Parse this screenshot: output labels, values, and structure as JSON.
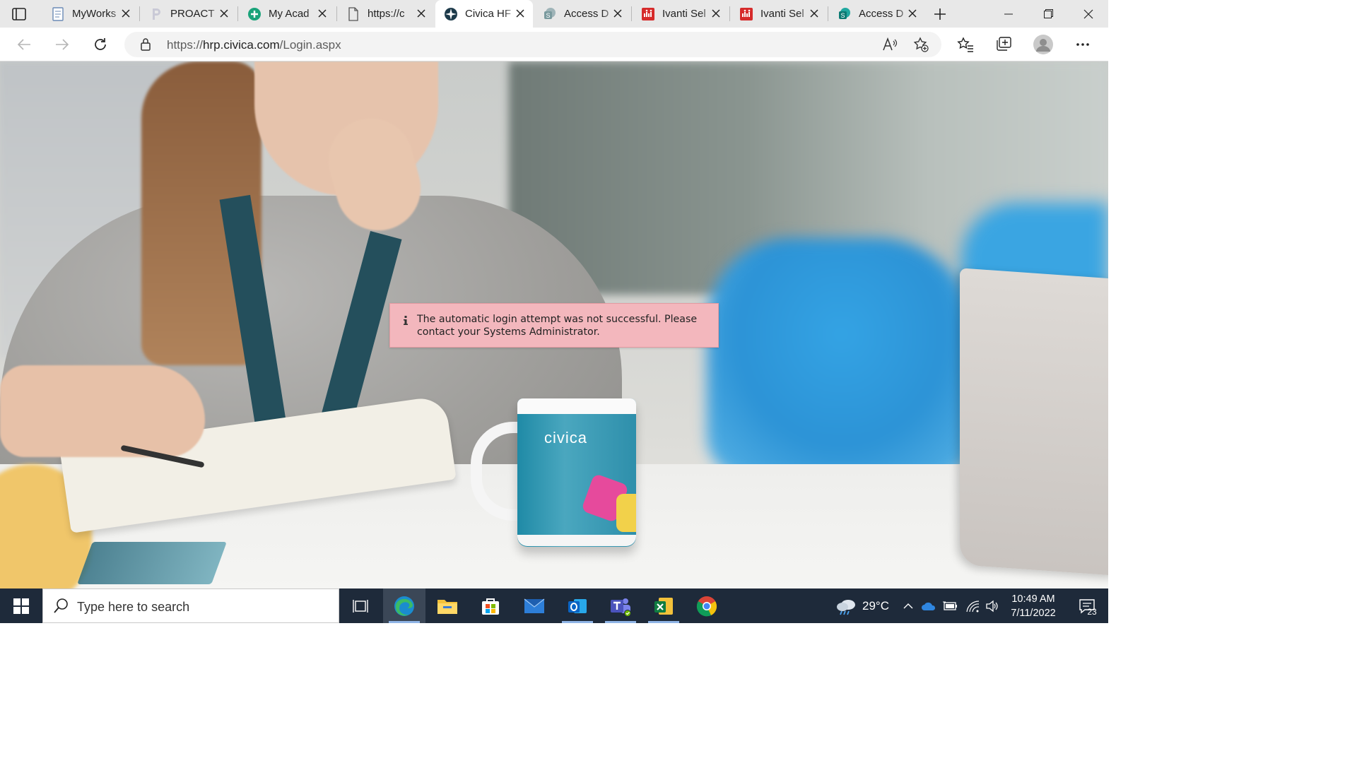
{
  "browser": {
    "tabs": [
      {
        "label": "MyWorks",
        "icon": "document-icon",
        "active": false
      },
      {
        "label": "PROACT",
        "icon": "proact-logo-icon",
        "active": false
      },
      {
        "label": "My Acad",
        "icon": "plus-circle-icon",
        "active": false
      },
      {
        "label": "https://c",
        "icon": "page-icon",
        "active": false
      },
      {
        "label": "Civica HF",
        "icon": "civica-logo-icon",
        "active": true
      },
      {
        "label": "Access D",
        "icon": "sharepoint-icon",
        "active": false
      },
      {
        "label": "Ivanti Sel",
        "icon": "ivanti-icon",
        "active": false
      },
      {
        "label": "Ivanti Sel",
        "icon": "ivanti-icon",
        "active": false
      },
      {
        "label": "Access D",
        "icon": "sharepoint-icon",
        "active": false
      }
    ],
    "url": {
      "scheme": "https://",
      "host": "hrp.civica.com",
      "path": "/Login.aspx"
    }
  },
  "page": {
    "alert": {
      "message": "The automatic login attempt was not successful. Please contact your Systems Administrator.",
      "icon": "info-icon"
    },
    "mug_text": "civica"
  },
  "taskbar": {
    "search_placeholder": "Type here to search",
    "apps": [
      "task-view-icon",
      "edge-icon",
      "file-explorer-icon",
      "microsoft-store-icon",
      "mail-icon",
      "outlook-icon",
      "teams-icon",
      "excel-icon",
      "chrome-icon"
    ],
    "weather": {
      "temp": "29°C"
    },
    "clock": {
      "time": "10:49 AM",
      "date": "7/11/2022"
    },
    "notifications_count": "23"
  },
  "colors": {
    "alert_bg": "#f3b7bd",
    "taskbar_bg": "#1e2a3a",
    "tabstrip_bg": "#e8e8e8"
  }
}
